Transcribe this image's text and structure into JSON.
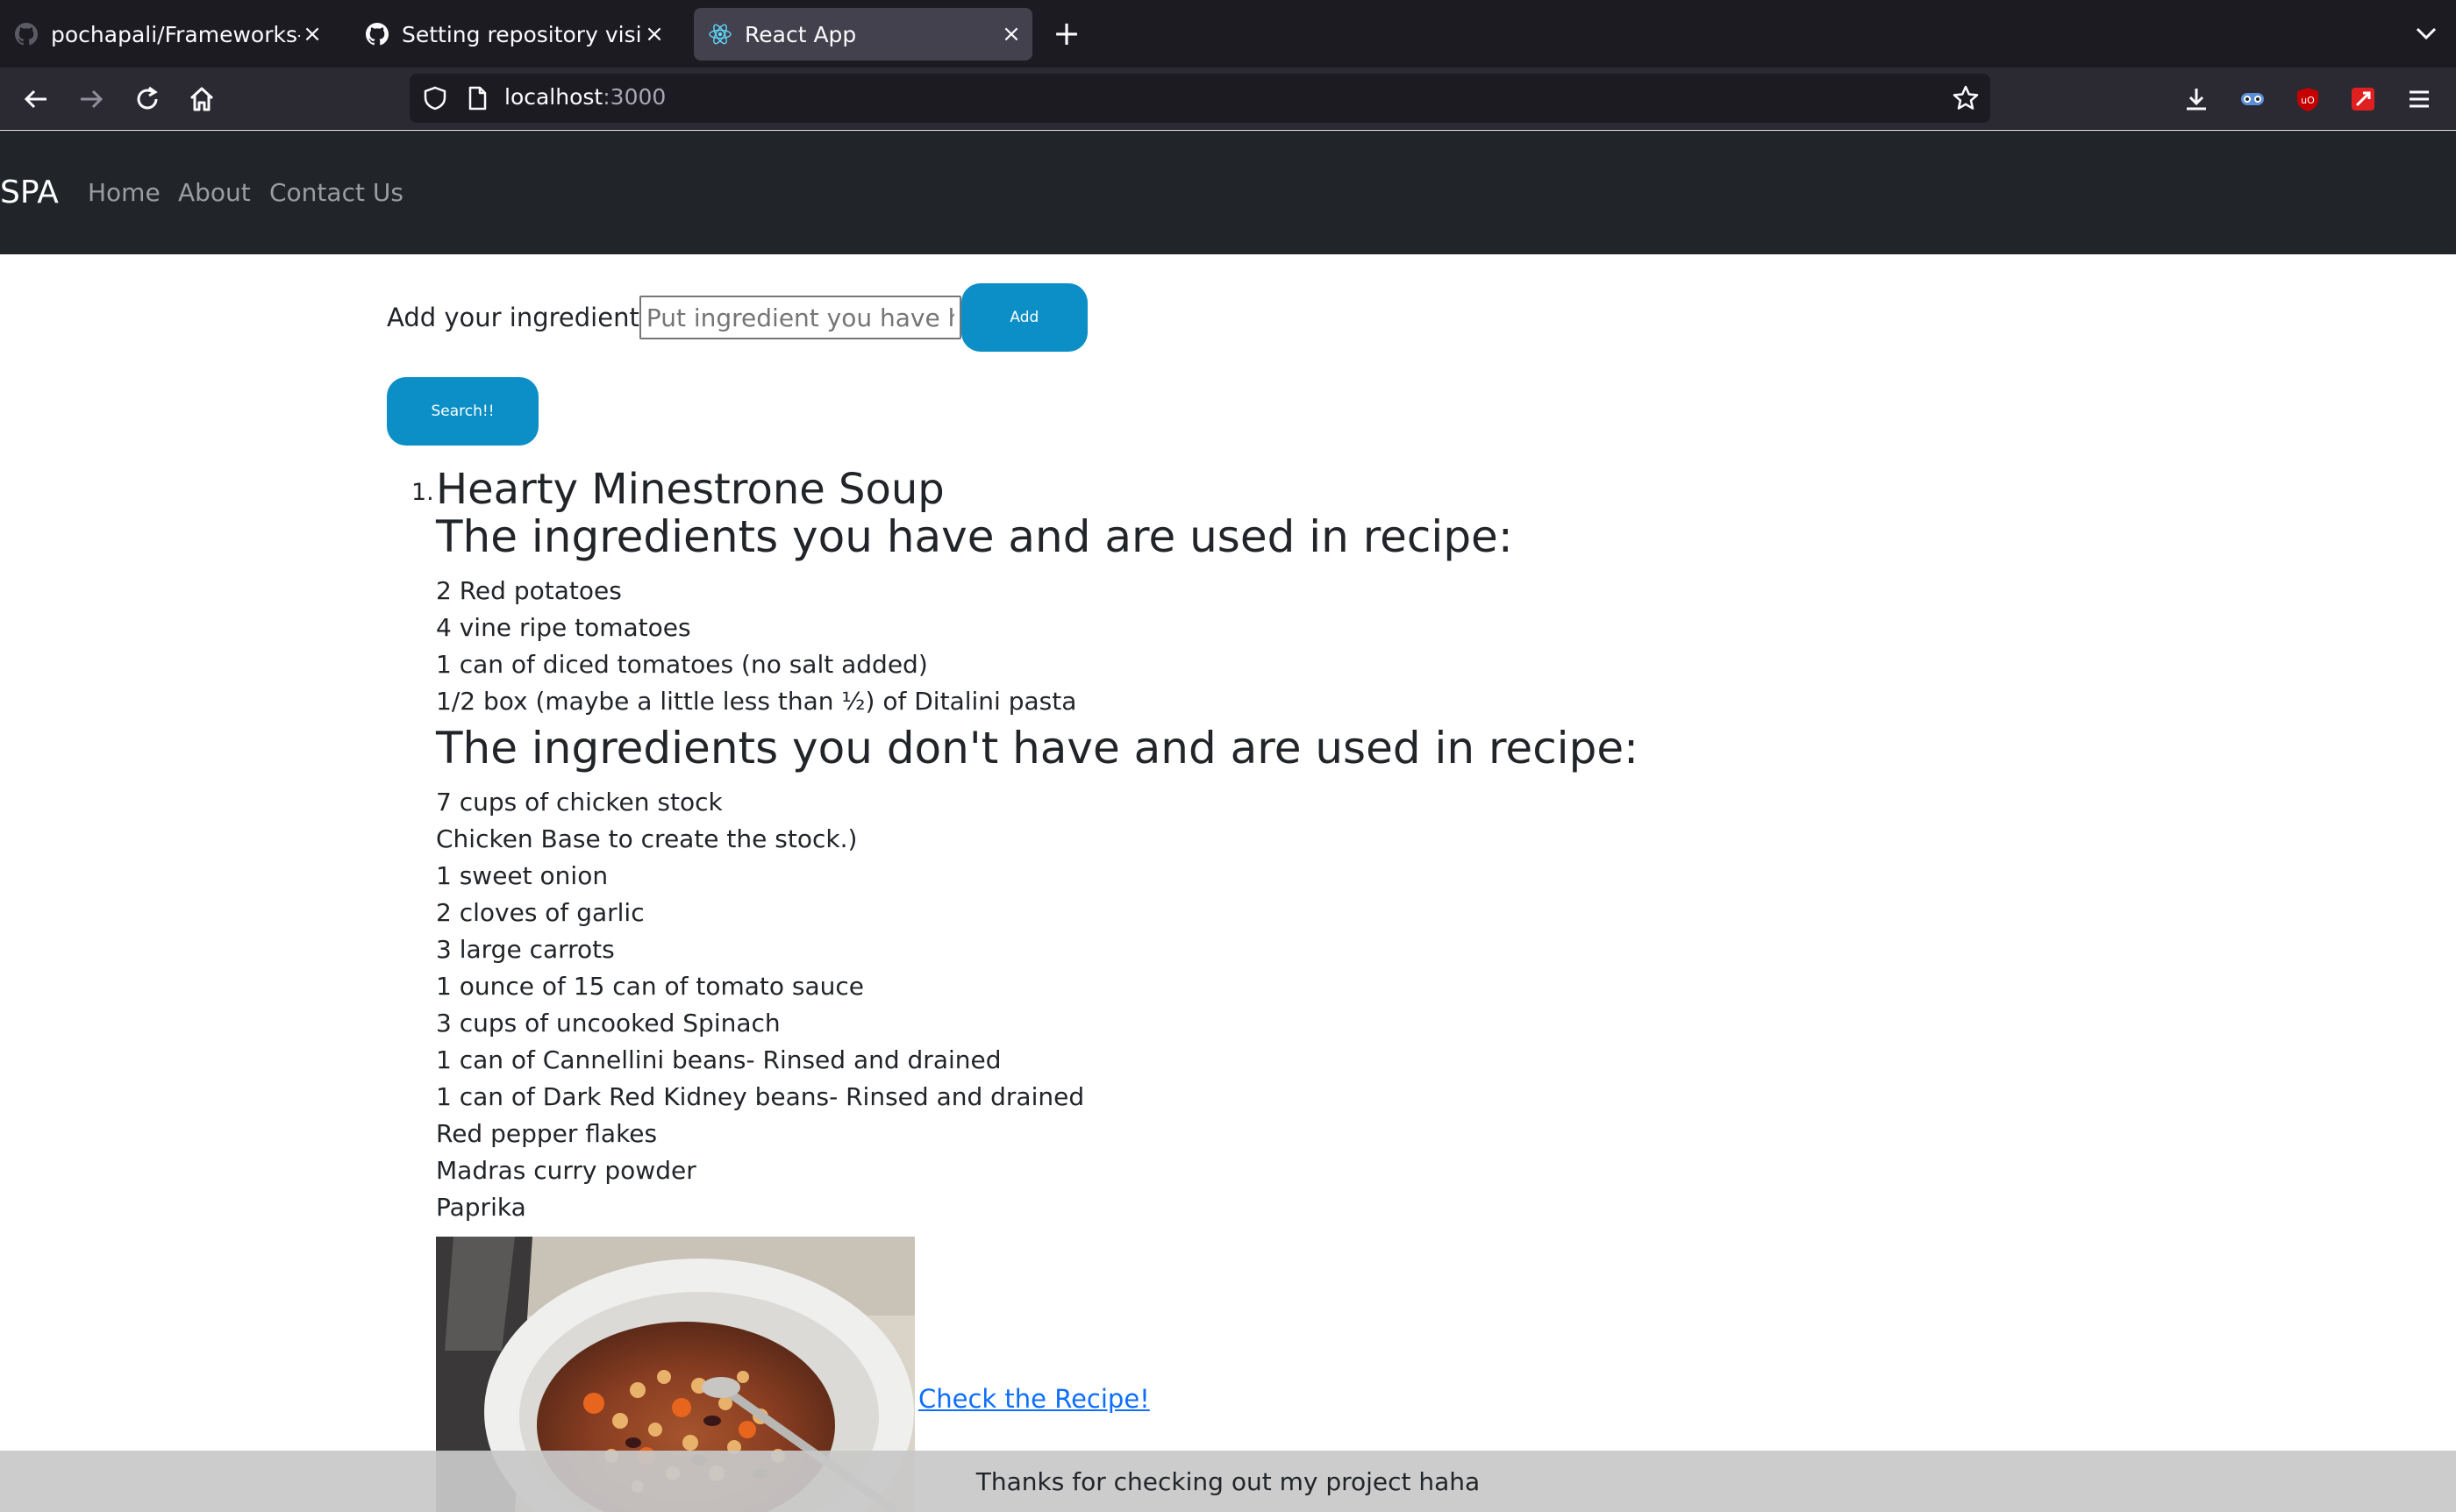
{
  "browser": {
    "tabs": [
      {
        "title": "pochapali/Frameworks-final",
        "favicon": "github-icon"
      },
      {
        "title": "Setting repository visibility",
        "favicon": "github-icon"
      },
      {
        "title": "React App",
        "favicon": "react-icon"
      }
    ],
    "url_host": "localhost",
    "url_port": ":3000"
  },
  "app": {
    "brand": "SPA",
    "nav": [
      "Home",
      "About",
      "Contact Us"
    ],
    "add_label": "Add your ingredient",
    "input_placeholder": "Put ingredient you have here",
    "input_value": "",
    "add_button": "Add",
    "search_button": "Search!!",
    "footer": "Thanks for checking out my project haha"
  },
  "recipe": {
    "number": "1.",
    "title": "Hearty Minestrone Soup",
    "have_heading": "The ingredients you have and are used in recipe:",
    "have": [
      "2 Red potatoes",
      "4 vine ripe tomatoes",
      "1 can of diced tomatoes (no salt added)",
      "1/2 box (maybe a little less than ½) of Ditalini pasta"
    ],
    "missing_heading": "The ingredients you don't have and are used in recipe:",
    "missing": [
      "7 cups of chicken stock",
      "Chicken Base to create the stock.)",
      "1 sweet onion",
      "2 cloves of garlic",
      "3 large carrots",
      "1 ounce of 15 can of tomato sauce",
      "3 cups of uncooked Spinach",
      "1 can of Cannellini beans- Rinsed and drained",
      "1 can of Dark Red Kidney beans- Rinsed and drained",
      "Red pepper flakes",
      "Madras curry powder",
      "Paprika"
    ],
    "link_text": "Check the Recipe!"
  }
}
